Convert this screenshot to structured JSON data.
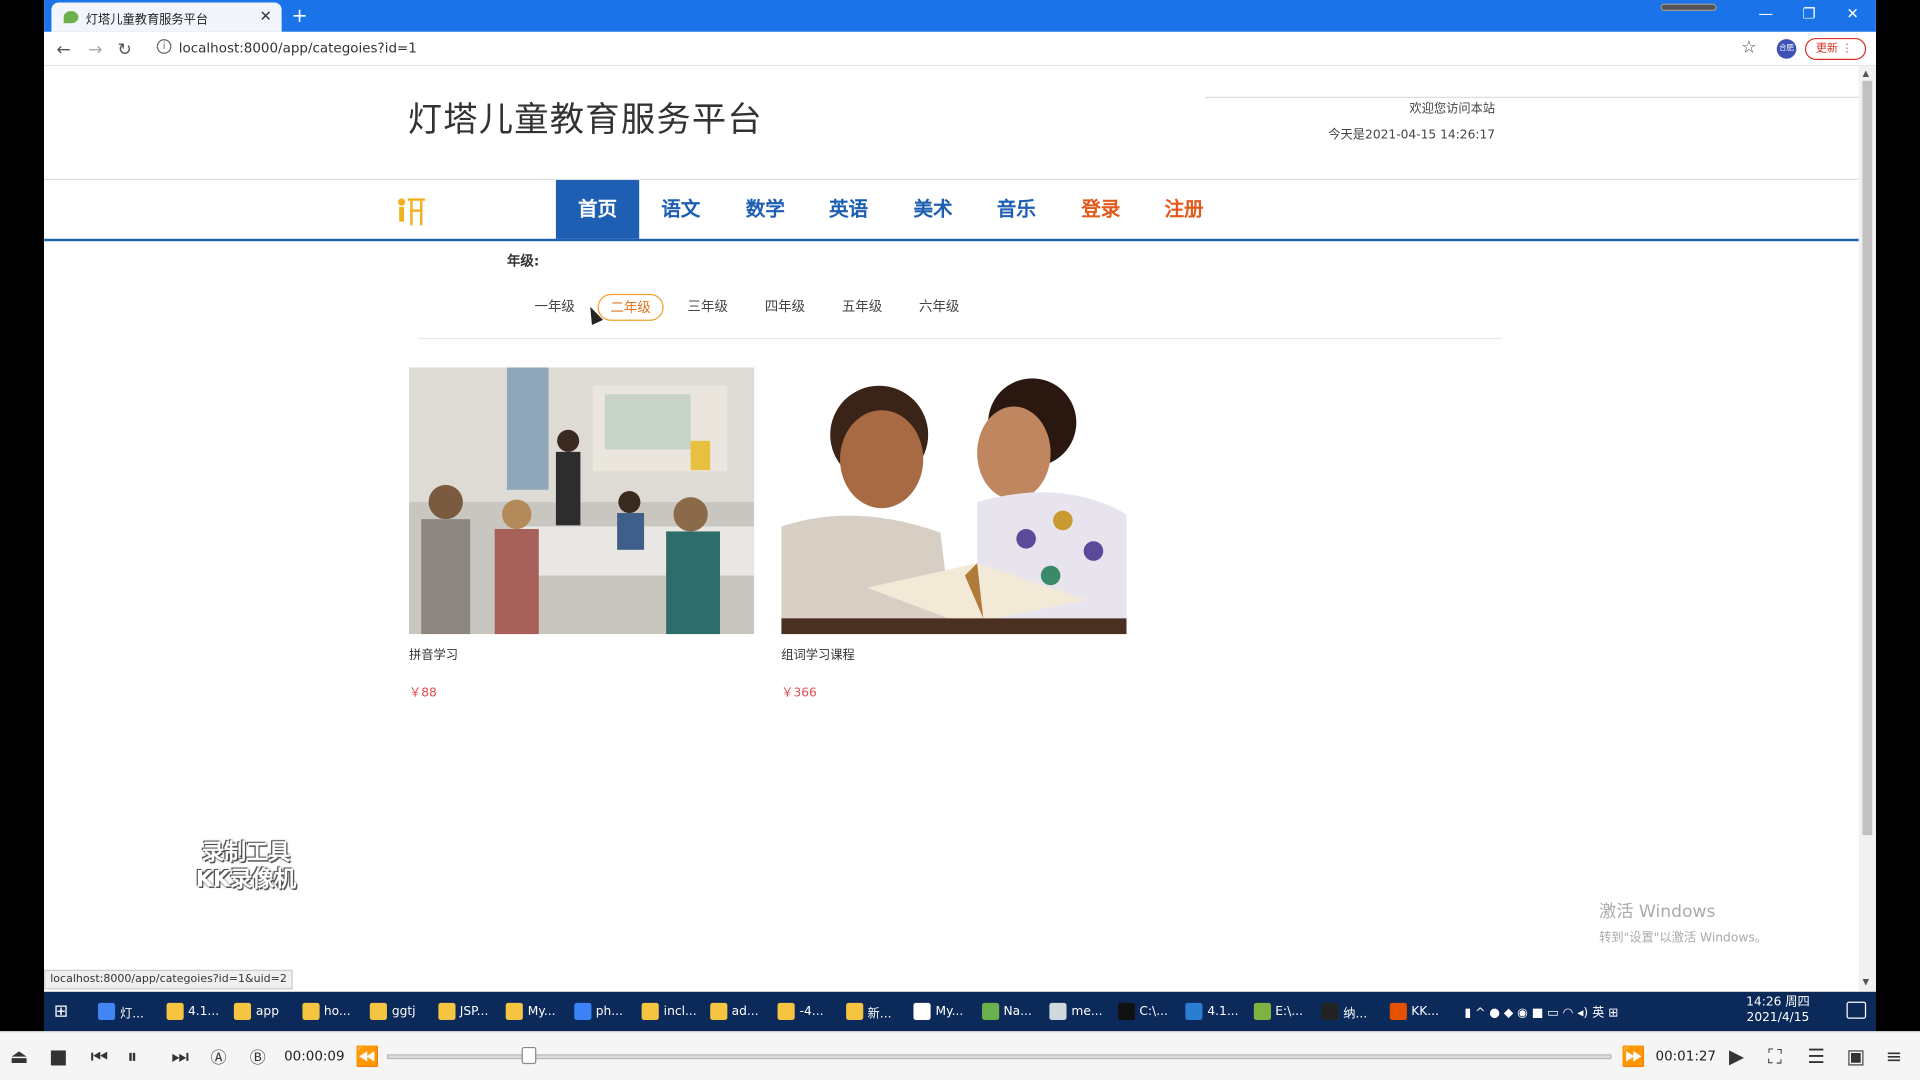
{
  "browser": {
    "tab_title": "灯塔儿童教育服务平台",
    "url": "localhost:8000/app/categoies?id=1",
    "update_label": "更新",
    "avatar_text": "合肥",
    "status_url": "localhost:8000/app/categoies?id=1&uid=2"
  },
  "site": {
    "title": "灯塔儿童教育服务平台",
    "welcome": "欢迎您访问本站",
    "today": "今天是2021-04-15 14:26:17",
    "menu": [
      "首页",
      "语文",
      "数学",
      "英语",
      "美术",
      "音乐",
      "登录",
      "注册"
    ],
    "active_menu": "首页",
    "grade_label": "年级:",
    "grades": [
      "一年级",
      "二年级",
      "三年级",
      "四年级",
      "五年级",
      "六年级"
    ],
    "selected_grade": "二年级"
  },
  "courses": [
    {
      "title": "拼音学习",
      "price": "￥88"
    },
    {
      "title": "组词学习课程",
      "price": "￥366"
    }
  ],
  "watermark": {
    "line1": "录制工具",
    "line2": "KK录像机"
  },
  "windows_activation": {
    "line1": "激活 Windows",
    "line2": "转到\"设置\"以激活 Windows。"
  },
  "taskbar": {
    "items": [
      "灯...",
      "4.1...",
      "app",
      "ho...",
      "ggtj",
      "JSP...",
      "My...",
      "ph...",
      "incl...",
      "ad...",
      "-4...",
      "新...",
      "My...",
      "Na...",
      "me...",
      "C:\\...",
      "4.1...",
      "E:\\...",
      "纳...",
      "KK..."
    ],
    "ime": "英",
    "time": "14:26 周四",
    "date": "2021/4/15"
  },
  "player": {
    "current_time": "00:00:09",
    "total_time": "00:01:27",
    "progress_fraction": 0.11
  },
  "colors": {
    "brand_blue": "#1e5fb3",
    "accent_orange": "#e05a1e",
    "price_red": "#e05050"
  }
}
